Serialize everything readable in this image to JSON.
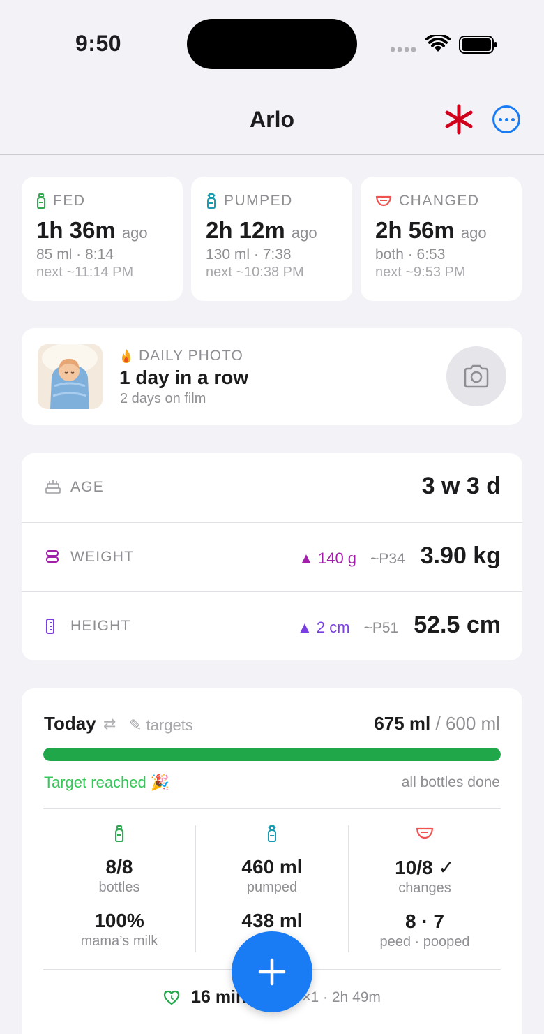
{
  "status_bar": {
    "time": "9:50"
  },
  "nav": {
    "title": "Arlo"
  },
  "stats": [
    {
      "label": "FED",
      "value": "1h 36m",
      "ago": "ago",
      "detail": "85 ml · 8:14",
      "next": "next ~11:14 PM",
      "color": "#34a853"
    },
    {
      "label": "PUMPED",
      "value": "2h 12m",
      "ago": "ago",
      "detail": "130 ml · 7:38",
      "next": "next ~10:38 PM",
      "color": "#1a9bb0"
    },
    {
      "label": "CHANGED",
      "value": "2h 56m",
      "ago": "ago",
      "detail": "both · 6:53",
      "next": "next ~9:53 PM",
      "color": "#ef5350"
    }
  ],
  "photo": {
    "label": "DAILY PHOTO",
    "title": "1 day in a row",
    "subtitle": "2 days on film"
  },
  "metrics": {
    "age": {
      "label": "AGE",
      "value": "3 w 3 d"
    },
    "weight": {
      "label": "WEIGHT",
      "delta": "▲ 140 g",
      "percentile": "~P34",
      "value": "3.90 kg",
      "color": "#a020a8"
    },
    "height": {
      "label": "HEIGHT",
      "delta": "▲ 2 cm",
      "percentile": "~P51",
      "value": "52.5 cm",
      "color": "#7a3fe0"
    }
  },
  "today": {
    "title": "Today",
    "swap": "⇄",
    "targets": "✎ targets",
    "total": "675 ml",
    "goal": "/ 600 ml",
    "progress": 1.0,
    "reached": "Target reached 🎉",
    "status": "all bottles done",
    "columns": [
      {
        "value": "8/8",
        "label": "bottles",
        "value2": "100%",
        "label2": "mama’s milk"
      },
      {
        "value": "460 ml",
        "label": "pumped",
        "value2": "438 ml",
        "label2": ""
      },
      {
        "value": "10/8 ✓",
        "label": "changes",
        "value2": "8 · 7",
        "label2": "peed · pooped"
      }
    ],
    "bottom": {
      "duration": "16 min",
      "rest": "×1 · 2h 49m"
    }
  },
  "colors": {
    "accent": "#1a7cf5",
    "green": "#1fa74a",
    "asterisk": "#d0021b"
  }
}
